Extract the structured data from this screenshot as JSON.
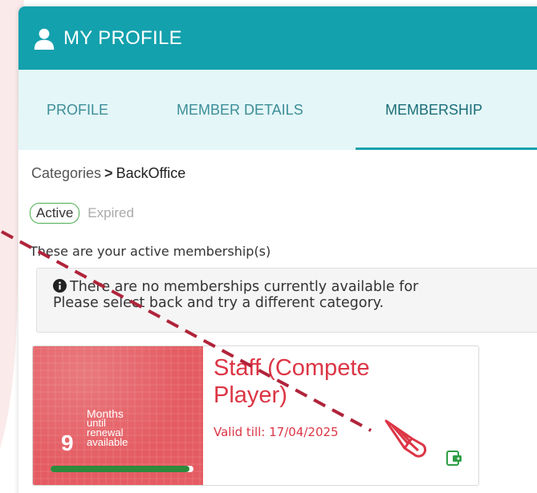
{
  "header": {
    "title": "MY PROFILE",
    "icon": "user-icon"
  },
  "tabs": [
    {
      "label": "PROFILE"
    },
    {
      "label": "MEMBER DETAILS"
    },
    {
      "label": "MEMBERSHIP",
      "active": true
    }
  ],
  "breadcrumb": {
    "parent": "Categories",
    "separator": ">",
    "current": "BackOffice"
  },
  "status_filter": {
    "active_label": "Active",
    "expired_label": "Expired",
    "selected": "Active"
  },
  "active_text": "These are your active membership(s)",
  "notice": {
    "line1": "There are no memberships currently available for",
    "line2": "Please select back and try a different category."
  },
  "membership_card": {
    "title_line1": "Staff (Compete",
    "title_line2": "Player)",
    "valid_till": "Valid till: 17/04/2025",
    "months_number": "9",
    "months_label_1": "Months",
    "months_label_2": "until",
    "months_label_3": "renewal",
    "months_label_4": "available",
    "progress_fraction": 0.97
  },
  "colors": {
    "header": "#13a1ad",
    "tabs_bg": "#e4f6f8",
    "card_red": "#e45c62",
    "title_red": "#dc3545",
    "progress_green": "#2e8b3d",
    "active_border": "#4caf50",
    "annotation_dash": "#b0243a"
  }
}
